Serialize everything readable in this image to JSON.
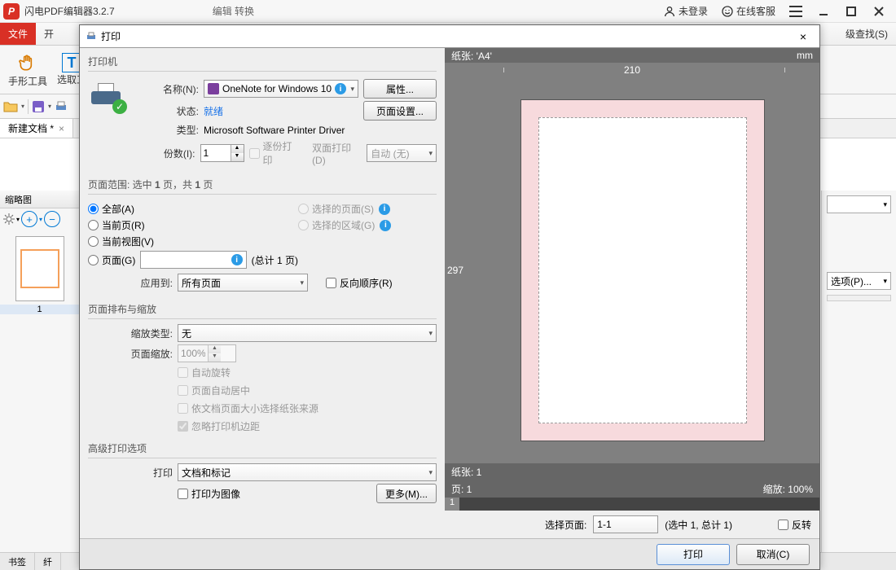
{
  "app": {
    "title": "闪电PDF编辑器3.2.7",
    "not_logged": "未登录",
    "support": "在线客服"
  },
  "menubar": {
    "file": "文件",
    "start": "开",
    "edit_convert": "编辑   转换",
    "adv_find": "级查找(S)"
  },
  "toolbar": {
    "hand": "手形工具",
    "select": "选取工"
  },
  "doc_tab": "新建文档 *",
  "thumb_panel": {
    "title": "缩略图",
    "page_num": "1"
  },
  "bottom": {
    "bookmarks": "书签"
  },
  "right_panel": {
    "options": "选项(P)..."
  },
  "dlg": {
    "title": "打印",
    "printer_section": "打印机",
    "name_lbl": "名称(N):",
    "printer_name": "OneNote for Windows 10",
    "properties_btn": "属性...",
    "status_lbl": "状态:",
    "status_val": "就绪",
    "pagesetup_btn": "页面设置...",
    "type_lbl": "类型:",
    "type_val": "Microsoft Software Printer Driver",
    "copies_lbl": "份数(I):",
    "copies_val": "1",
    "collate": "逐份打印",
    "duplex_lbl": "双面打印(D)",
    "duplex_val": "自动 (无)",
    "range_section": "页面范围: 选中 1 页，共 1 页",
    "range_all": "全部(A)",
    "range_current": "当前页(R)",
    "range_view": "当前视图(V)",
    "range_pages": "页面(G)",
    "range_selected_pages": "选择的页面(S)",
    "range_selected_region": "选择的区域(G)",
    "range_total": "(总计 1 页)",
    "applyto_lbl": "应用到:",
    "applyto_val": "所有页面",
    "reverse": "反向顺序(R)",
    "layout_section": "页面排布与缩放",
    "scale_type_lbl": "缩放类型:",
    "scale_type_val": "无",
    "page_scale_lbl": "页面缩放:",
    "page_scale_val": "100%",
    "auto_rotate": "自动旋转",
    "auto_center": "页面自动居中",
    "by_source": "依文档页面大小选择纸张来源",
    "ignore_margins": "忽略打印机边距",
    "adv_section": "高级打印选项",
    "print_lbl": "打印",
    "print_what": "文档和标记",
    "as_image": "打印为图像",
    "more_btn": "更多(M)...",
    "preview_paper": "纸张: 'A4'",
    "preview_unit": "mm",
    "preview_w": "210",
    "preview_h": "297",
    "preview_paper2": "纸张: 1",
    "preview_page": "页: 1",
    "preview_zoom": "缩放: 100%",
    "preview_pg1": "1",
    "select_page_lbl": "选择页面:",
    "select_page_val": "1-1",
    "select_page_total": "(选中 1, 总计 1)",
    "reverse2": "反转",
    "ok_btn": "打印",
    "cancel_btn": "取消(C)"
  }
}
